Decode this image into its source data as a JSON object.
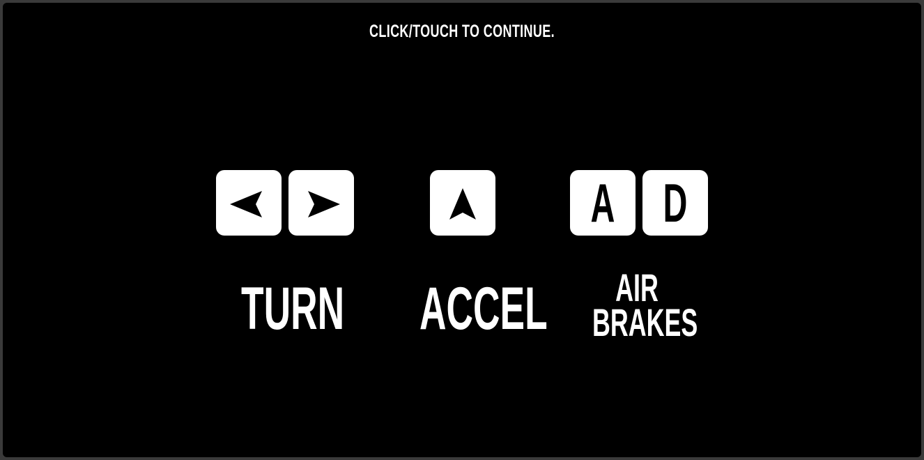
{
  "prompt": "CLICK/TOUCH TO CONTINUE.",
  "controls": [
    {
      "keys": [
        {
          "type": "icon",
          "icon": "arrow-left-icon"
        },
        {
          "type": "icon",
          "icon": "arrow-right-icon"
        }
      ],
      "label": "TURN"
    },
    {
      "keys": [
        {
          "type": "icon",
          "icon": "arrow-up-icon"
        }
      ],
      "label": "ACCEL"
    },
    {
      "keys": [
        {
          "type": "letter",
          "letter": "A"
        },
        {
          "type": "letter",
          "letter": "D"
        }
      ],
      "label_lines": [
        "AIR",
        "BRAKES"
      ]
    }
  ],
  "colors": {
    "background": "#000000",
    "frame": "#3a3a3a",
    "key": "#ffffff",
    "text": "#ffffff"
  }
}
